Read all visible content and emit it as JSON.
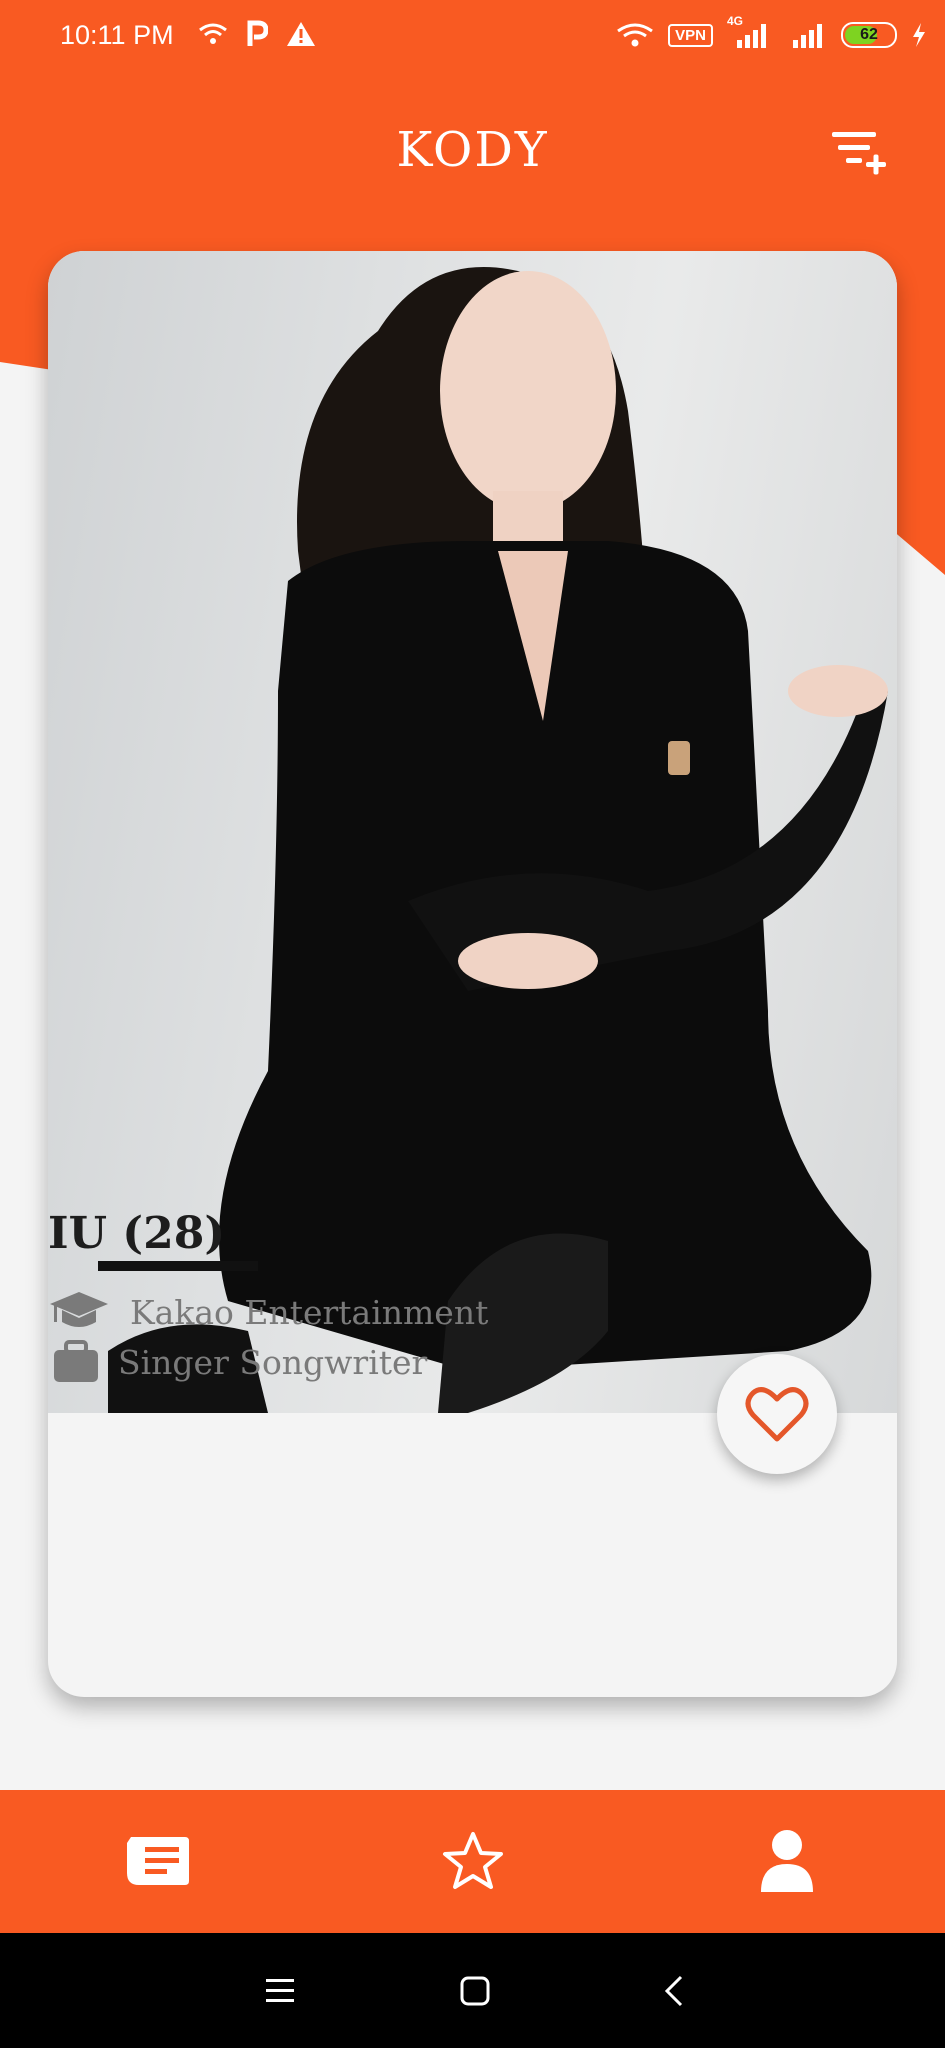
{
  "status_bar": {
    "time": "10:11 PM",
    "vpn_label": "VPN",
    "network_label": "4G",
    "battery_level": "62",
    "icons": [
      "wifi-icon",
      "parking-icon",
      "warning-icon",
      "wifi-icon",
      "signal-icon",
      "signal-icon",
      "charging-icon"
    ]
  },
  "header": {
    "title": "KODY",
    "filter_icon": "filter-add-icon"
  },
  "profile_card": {
    "photo_alt": "Profile photo",
    "name": "IU (28)",
    "company": "Kakao Entertainment",
    "occupation": "Singer Songwriter",
    "favorite_icon": "heart-icon"
  },
  "bottom_nav": {
    "items": [
      {
        "icon": "feed-icon"
      },
      {
        "icon": "star-icon"
      },
      {
        "icon": "user-icon"
      }
    ]
  },
  "system_nav": {
    "items": [
      {
        "icon": "menu-icon"
      },
      {
        "icon": "home-icon"
      },
      {
        "icon": "back-icon"
      }
    ]
  },
  "colors": {
    "accent": "#f95a22",
    "background": "#f4f4f4",
    "text_dark": "#1d1d1d",
    "text_muted": "#7a7a7a"
  }
}
